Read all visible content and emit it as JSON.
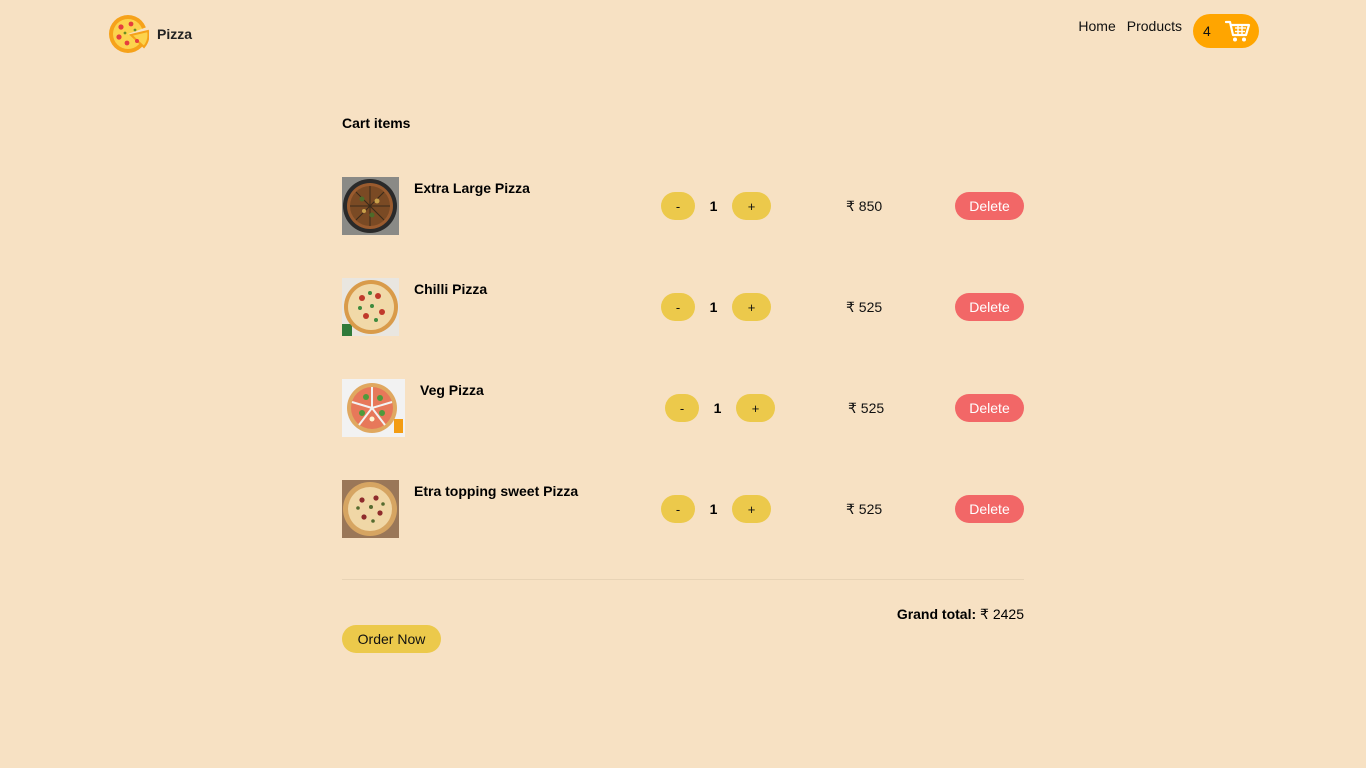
{
  "brand": {
    "name": "Pizza",
    "logo_icon": "pizza-logo-icon"
  },
  "nav": {
    "home": "Home",
    "products": "Products"
  },
  "cart_badge": {
    "count": "4",
    "icon": "shopping-cart-icon"
  },
  "cart": {
    "title": "Cart items",
    "items": [
      {
        "name": "Extra Large Pizza",
        "qty": "1",
        "price": "₹ 850",
        "image_icon": "pizza-image"
      },
      {
        "name": "Chilli Pizza",
        "qty": "1",
        "price": "₹ 525",
        "image_icon": "pizza-image"
      },
      {
        "name": "Veg Pizza",
        "qty": "1",
        "price": "₹ 525",
        "image_icon": "pizza-image"
      },
      {
        "name": "Etra topping sweet Pizza",
        "qty": "1",
        "price": "₹ 525",
        "image_icon": "pizza-image"
      }
    ],
    "minus_label": "-",
    "plus_label": "+",
    "delete_label": "Delete",
    "grand_total_label": "Grand total:",
    "grand_total_value": "₹ 2425",
    "order_label": "Order Now"
  },
  "colors": {
    "background": "#f7e1c3",
    "accent_orange": "#ffa500",
    "button_yellow": "#ecc94b",
    "delete_red": "#f26767"
  }
}
